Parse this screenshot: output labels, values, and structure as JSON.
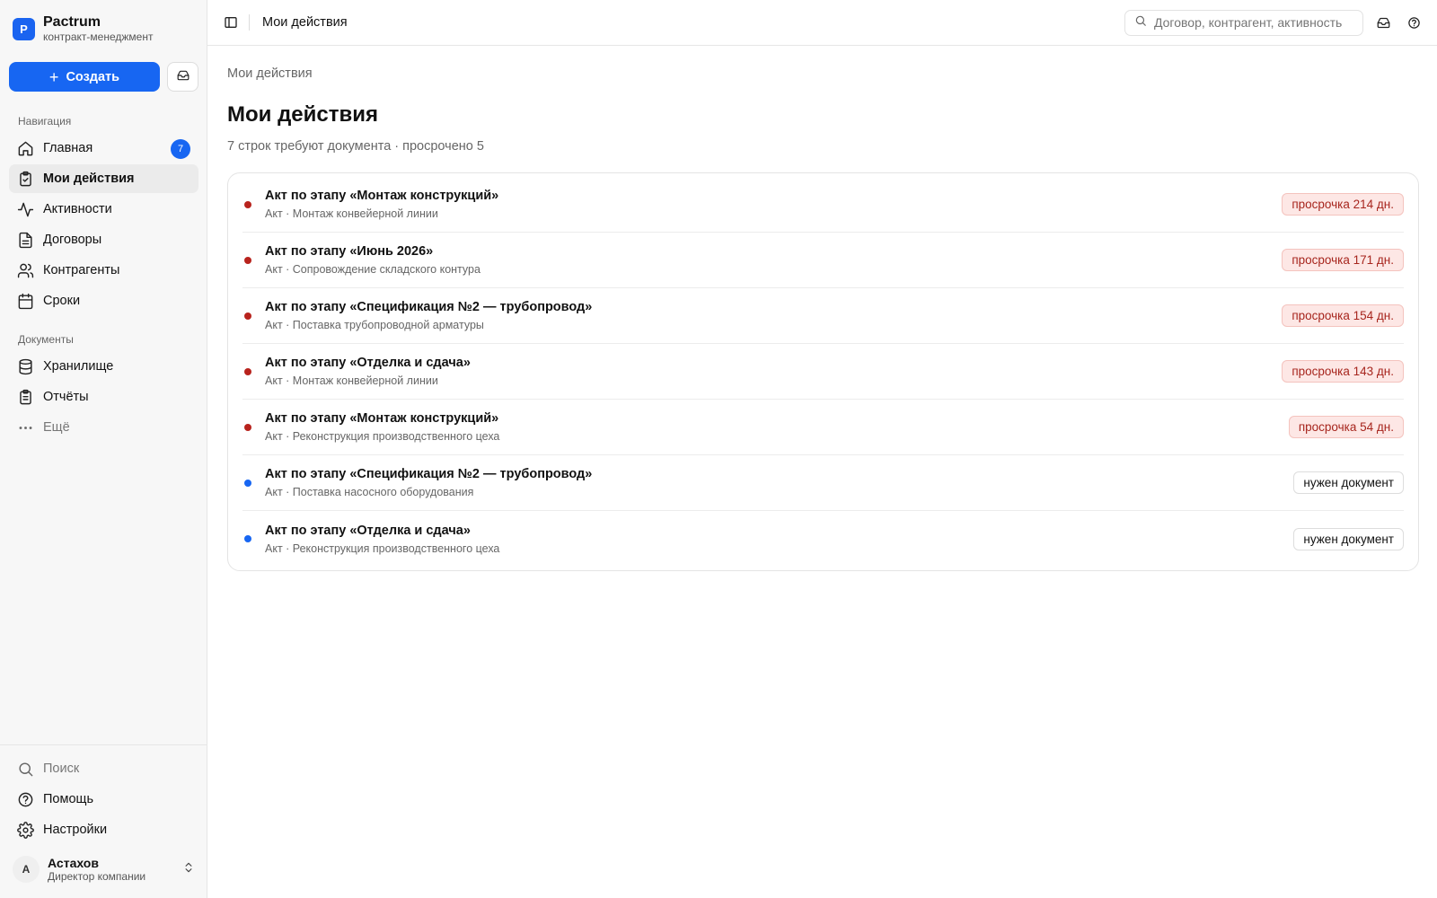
{
  "brand": {
    "logo_letter": "P",
    "name": "Pactrum",
    "subtitle": "контракт-менеджмент"
  },
  "create_label": "Создать",
  "sections": {
    "navigation": "Навигация",
    "documents": "Документы"
  },
  "nav": [
    {
      "label": "Главная",
      "icon": "home-icon",
      "badge": "7"
    },
    {
      "label": "Мои действия",
      "icon": "clipboard-check-icon",
      "active": true
    },
    {
      "label": "Активности",
      "icon": "activity-icon"
    },
    {
      "label": "Договоры",
      "icon": "document-icon"
    },
    {
      "label": "Контрагенты",
      "icon": "users-icon"
    },
    {
      "label": "Сроки",
      "icon": "calendar-icon"
    }
  ],
  "docs_nav": [
    {
      "label": "Хранилище",
      "icon": "database-icon"
    },
    {
      "label": "Отчёты",
      "icon": "report-icon"
    },
    {
      "label": "Ещё",
      "icon": "more-icon"
    }
  ],
  "bottom_nav": [
    {
      "label": "Поиск",
      "icon": "search-icon"
    },
    {
      "label": "Помощь",
      "icon": "help-icon"
    },
    {
      "label": "Настройки",
      "icon": "gear-icon"
    }
  ],
  "user": {
    "initial": "А",
    "name": "Астахов",
    "role": "Директор компании"
  },
  "topbar": {
    "title": "Мои действия",
    "search_placeholder": "Договор, контрагент, активность"
  },
  "page": {
    "breadcrumb": "Мои действия",
    "title": "Мои действия",
    "subtitle": "7 строк требуют документа · просрочено 5"
  },
  "rows": [
    {
      "title": "Акт по этапу «Монтаж конструкций»",
      "sub": "Акт · Монтаж конвейерной линии",
      "status": "overdue",
      "badge": "просрочка 214 дн."
    },
    {
      "title": "Акт по этапу «Июнь 2026»",
      "sub": "Акт · Сопровождение складского контура",
      "status": "overdue",
      "badge": "просрочка 171 дн."
    },
    {
      "title": "Акт по этапу «Спецификация №2 — трубопровод»",
      "sub": "Акт · Поставка трубопроводной арматуры",
      "status": "overdue",
      "badge": "просрочка 154 дн."
    },
    {
      "title": "Акт по этапу «Отделка и сдача»",
      "sub": "Акт · Монтаж конвейерной линии",
      "status": "overdue",
      "badge": "просрочка 143 дн."
    },
    {
      "title": "Акт по этапу «Монтаж конструкций»",
      "sub": "Акт · Реконструкция производственного цеха",
      "status": "overdue",
      "badge": "просрочка 54 дн."
    },
    {
      "title": "Акт по этапу «Спецификация №2 — трубопровод»",
      "sub": "Акт · Поставка насосного оборудования",
      "status": "need",
      "badge": "нужен документ"
    },
    {
      "title": "Акт по этапу «Отделка и сдача»",
      "sub": "Акт · Реконструкция производственного цеха",
      "status": "need",
      "badge": "нужен документ"
    }
  ],
  "colors": {
    "accent": "#1766f2",
    "overdue": "#b8231d",
    "overdue_bg": "#fde7e5"
  }
}
